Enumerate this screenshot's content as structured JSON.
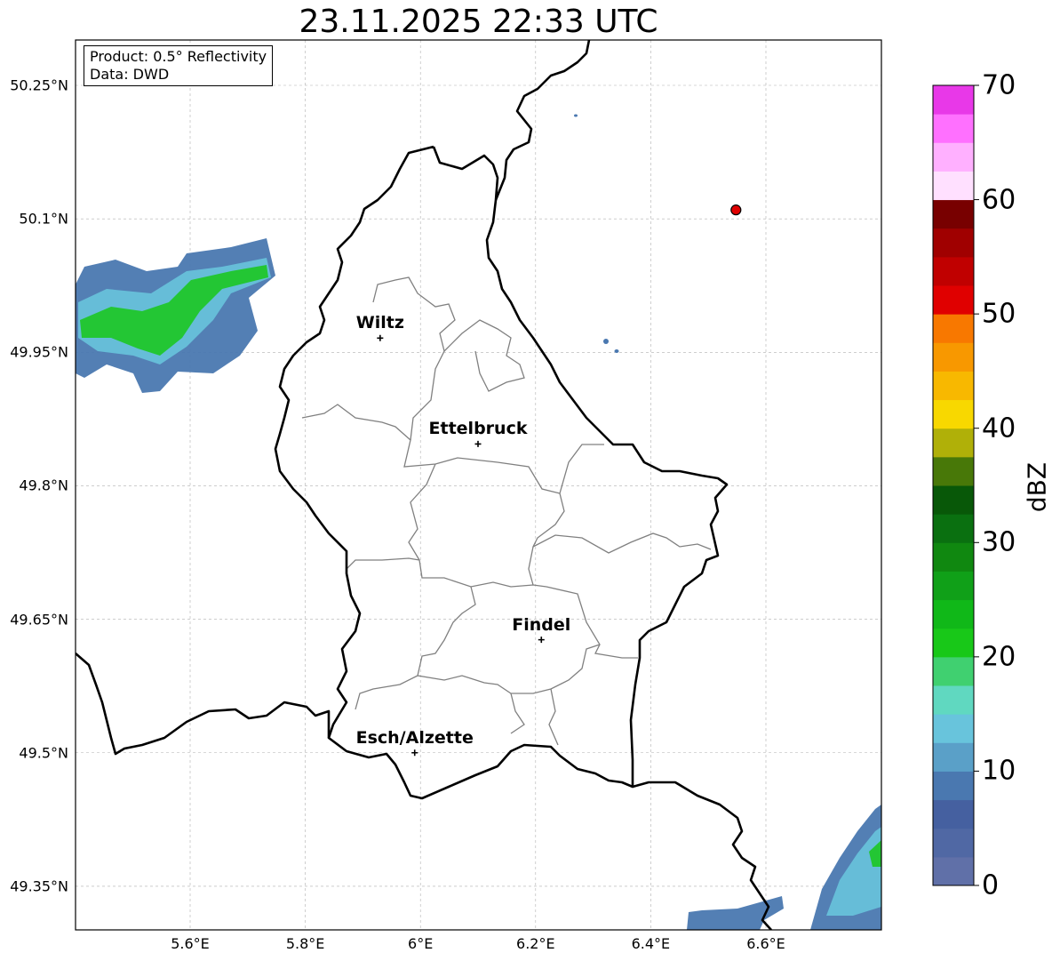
{
  "title": "23.11.2025 22:33 UTC",
  "info": {
    "product": "Product: 0.5° Reflectivity",
    "data": "Data: DWD"
  },
  "lat_ticks": [
    "50.25°N",
    "50.1°N",
    "49.95°N",
    "49.8°N",
    "49.65°N",
    "49.5°N",
    "49.35°N"
  ],
  "lon_ticks": [
    "5.6°E",
    "5.8°E",
    "6°E",
    "6.2°E",
    "6.4°E",
    "6.6°E"
  ],
  "cities": [
    {
      "name": "Wiltz",
      "lon": 5.93,
      "lat": 49.966
    },
    {
      "name": "Ettelbruck",
      "lon": 6.1,
      "lat": 49.847
    },
    {
      "name": "Findel",
      "lon": 6.21,
      "lat": 49.627
    },
    {
      "name": "Esch/Alzette",
      "lon": 5.99,
      "lat": 49.5
    }
  ],
  "radar_site": {
    "lon": 6.548,
    "lat": 50.11,
    "color": "#e00000"
  },
  "colorbar": {
    "label": "dBZ",
    "ticks": [
      "0",
      "10",
      "20",
      "30",
      "40",
      "50",
      "60",
      "70"
    ],
    "min": 0,
    "max": 70,
    "colors": [
      "#6070a8",
      "#5068a4",
      "#4560a0",
      "#4a78b0",
      "#5aa0c8",
      "#68c4dc",
      "#60d8c0",
      "#40d070",
      "#18c818",
      "#10b818",
      "#10a018",
      "#108810",
      "#0a7010",
      "#085808",
      "#487808",
      "#b0b008",
      "#f8d800",
      "#f8b800",
      "#f89800",
      "#f87800",
      "#e00000",
      "#c00000",
      "#a00000",
      "#780000",
      "#ffe0ff",
      "#ffb0ff",
      "#ff70ff",
      "#e838e8"
    ]
  },
  "colors": {
    "border": "#000000",
    "canton": "#808080",
    "grid": "#b0b0b0"
  }
}
